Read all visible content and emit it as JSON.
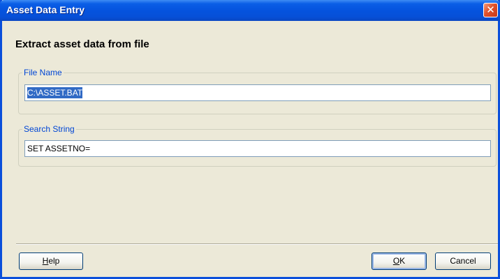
{
  "window": {
    "title": "Asset Data Entry",
    "close_glyph": "✕"
  },
  "heading": "Extract asset data from file",
  "file_group": {
    "legend": "File Name",
    "value": "C:\\ASSET.BAT"
  },
  "search_group": {
    "legend": "Search String",
    "value": "SET ASSETNO="
  },
  "buttons": {
    "help": {
      "mnemonic": "H",
      "rest": "elp"
    },
    "ok": {
      "mnemonic": "O",
      "rest": "K"
    },
    "cancel": "Cancel"
  },
  "colors": {
    "titlebar": "#0553de",
    "dialog_bg": "#ece9d8",
    "legend_text": "#0046d5",
    "selection": "#316ac5",
    "close_button": "#e0512a"
  }
}
